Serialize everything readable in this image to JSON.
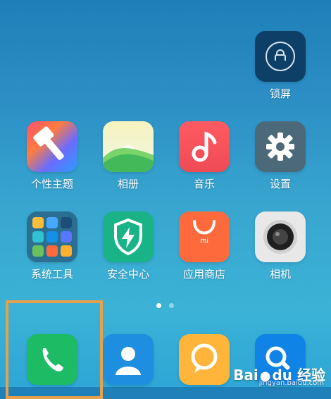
{
  "home": {
    "apps": [
      {
        "label": "锁屏"
      },
      {
        "label": "个性主题"
      },
      {
        "label": "相册"
      },
      {
        "label": "音乐"
      },
      {
        "label": "设置"
      },
      {
        "label": "系统工具"
      },
      {
        "label": "安全中心"
      },
      {
        "label": "应用商店"
      },
      {
        "label": "相机"
      }
    ],
    "dock": [
      {
        "label": "Phone"
      },
      {
        "label": "Contacts"
      },
      {
        "label": "Messages"
      },
      {
        "label": "Browser"
      }
    ]
  },
  "store_logo_text": "mi",
  "watermark": {
    "brand": "Bai",
    "brand2": "du",
    "suffix": "经验",
    "url": "jingyan.baidu.com"
  },
  "colors": {
    "highlight": "#e7a14a",
    "background_top": "#1f7fb8",
    "background_bottom": "#2ea6d6"
  },
  "icons": {
    "lock": "lock-icon",
    "theme": "paint-brush-icon",
    "gallery": "gallery-icon",
    "music": "music-note-icon",
    "settings": "gear-icon",
    "tools": "folder-icon",
    "security": "shield-bolt-icon",
    "store": "shopping-bag-icon",
    "camera": "camera-lens-icon",
    "phone": "phone-icon",
    "contacts": "person-icon",
    "messages": "chat-bubble-icon",
    "browser": "browser-icon"
  }
}
